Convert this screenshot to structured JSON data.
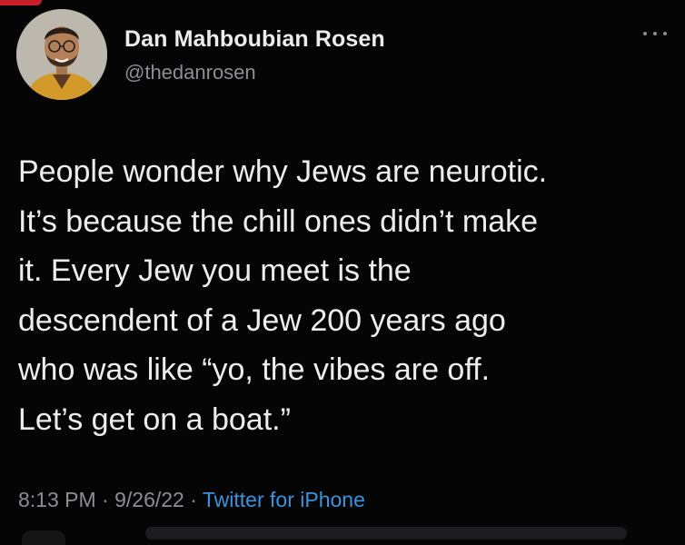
{
  "user": {
    "display_name": "Dan Mahboubian Rosen",
    "handle": "@thedanrosen"
  },
  "tweet": {
    "lines": [
      "People wonder why Jews are neurotic.",
      "It’s because the chill ones didn’t make",
      "it. Every Jew you meet is the",
      "descendent of a Jew 200 years ago",
      "who was like “yo, the vibes are off.",
      "Let’s get on a boat.”"
    ],
    "time": "8:13 PM",
    "separator": " · ",
    "date": "9/26/22",
    "source": "Twitter for iPhone"
  },
  "icons": {
    "more": "more-options-icon",
    "avatar": "profile-photo"
  },
  "colors": {
    "background": "#050505",
    "text": "#ededed",
    "muted": "#8b8f94",
    "link": "#3a93dd"
  }
}
